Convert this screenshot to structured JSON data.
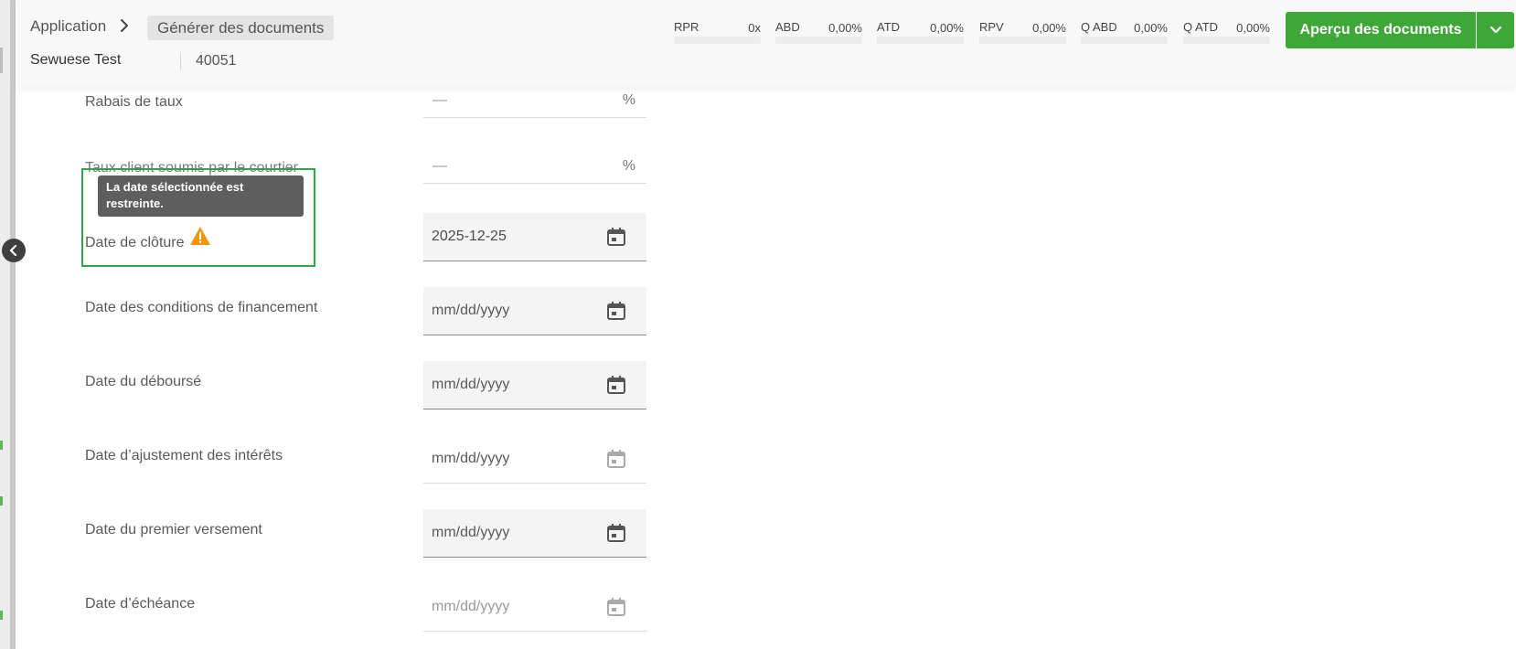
{
  "header": {
    "breadcrumb_root": "Application",
    "breadcrumb_current": "Générer des documents",
    "client_name": "Sewuese Test",
    "file_number": "40051",
    "metrics": [
      {
        "label": "RPR",
        "value": "0x"
      },
      {
        "label": "ABD",
        "value": "0,00%"
      },
      {
        "label": "ATD",
        "value": "0,00%"
      },
      {
        "label": "RPV",
        "value": "0,00%"
      },
      {
        "label": "Q ABD",
        "value": "0,00%"
      },
      {
        "label": "Q ATD",
        "value": "0,00%"
      }
    ],
    "preview_button": "Aperçu des documents"
  },
  "form": {
    "rate_discount": {
      "label": "Rabais de taux",
      "value": "—",
      "unit": "%"
    },
    "broker_rate": {
      "label": "Taux client soumis par le courtier",
      "value": "—",
      "unit": "%"
    },
    "tooltip": "La date sélectionnée est restreinte.",
    "closing_date": {
      "label": "Date de clôture",
      "value": "2025-12-25"
    },
    "financing_conditions_date": {
      "label": "Date des conditions de financement",
      "placeholder": "mm/dd/yyyy"
    },
    "disbursement_date": {
      "label": "Date du déboursé",
      "placeholder": "mm/dd/yyyy"
    },
    "interest_adjustment_date": {
      "label": "Date d’ajustement des intérêts",
      "placeholder": "mm/dd/yyyy"
    },
    "first_payment_date": {
      "label": "Date du premier versement",
      "placeholder": "mm/dd/yyyy"
    },
    "maturity_date": {
      "label": "Date d’échéance",
      "placeholder": "mm/dd/yyyy"
    }
  },
  "colors": {
    "accent_green": "#3ea737",
    "warning_orange": "#f0960e",
    "highlight_green": "#2aa84a"
  }
}
